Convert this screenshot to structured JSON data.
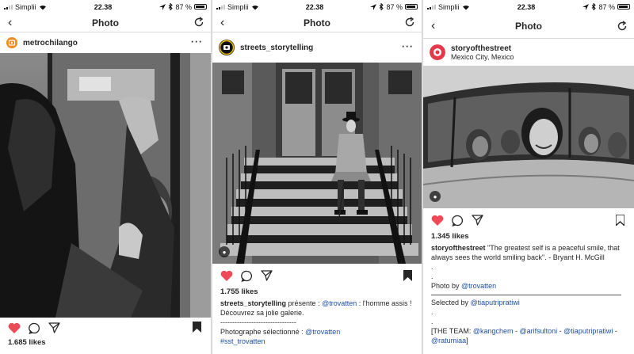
{
  "status": {
    "carrier": "Simplii",
    "time": "22.38",
    "battery": "87 %"
  },
  "nav": {
    "title": "Photo"
  },
  "posts": [
    {
      "username": "metrochilango",
      "likes": "1.685 likes"
    },
    {
      "username": "streets_storytelling",
      "likes": "1.755 likes",
      "caption_user": "streets_storytelling",
      "caption_text1": " présente : ",
      "caption_mention1": "@trovatten",
      "caption_text2": " : l'homme assis ! Découvrez sa jolie galerie.",
      "caption_divider": "--------------------------------",
      "caption_text3": "Photographe sélectionné : ",
      "caption_mention2": "@trovatten",
      "caption_hashtag": "#sst_trovatten"
    },
    {
      "username": "storyofthestreet",
      "location": "Mexico City, Mexico",
      "likes": "1.345 likes",
      "caption_user": "storyofthestreet",
      "caption_text1": " \"The greatest self is a peaceful smile, that always sees the world smiling back\". - Bryant H. McGill",
      "dot": ".",
      "photo_by_label": "Photo by ",
      "photo_by_mention": "@trovatten",
      "selected_by_label": "Selected by ",
      "selected_by_mention": "@tiaputripratiwi",
      "team_label": "[THE TEAM: ",
      "team_mention1": "@kangchem",
      "team_sep": " - ",
      "team_mention2": "@arifsultoni",
      "team_mention3": "@tiaputripratiwi",
      "team_mention4": "@ratumiaa",
      "team_end": "]"
    }
  ],
  "colors": {
    "like_heart": "#ed4956",
    "link": "#1d4fa0",
    "avatar_metrochilango": "#f28a1e",
    "avatar_storyofthestreet": "#e23a4a"
  }
}
